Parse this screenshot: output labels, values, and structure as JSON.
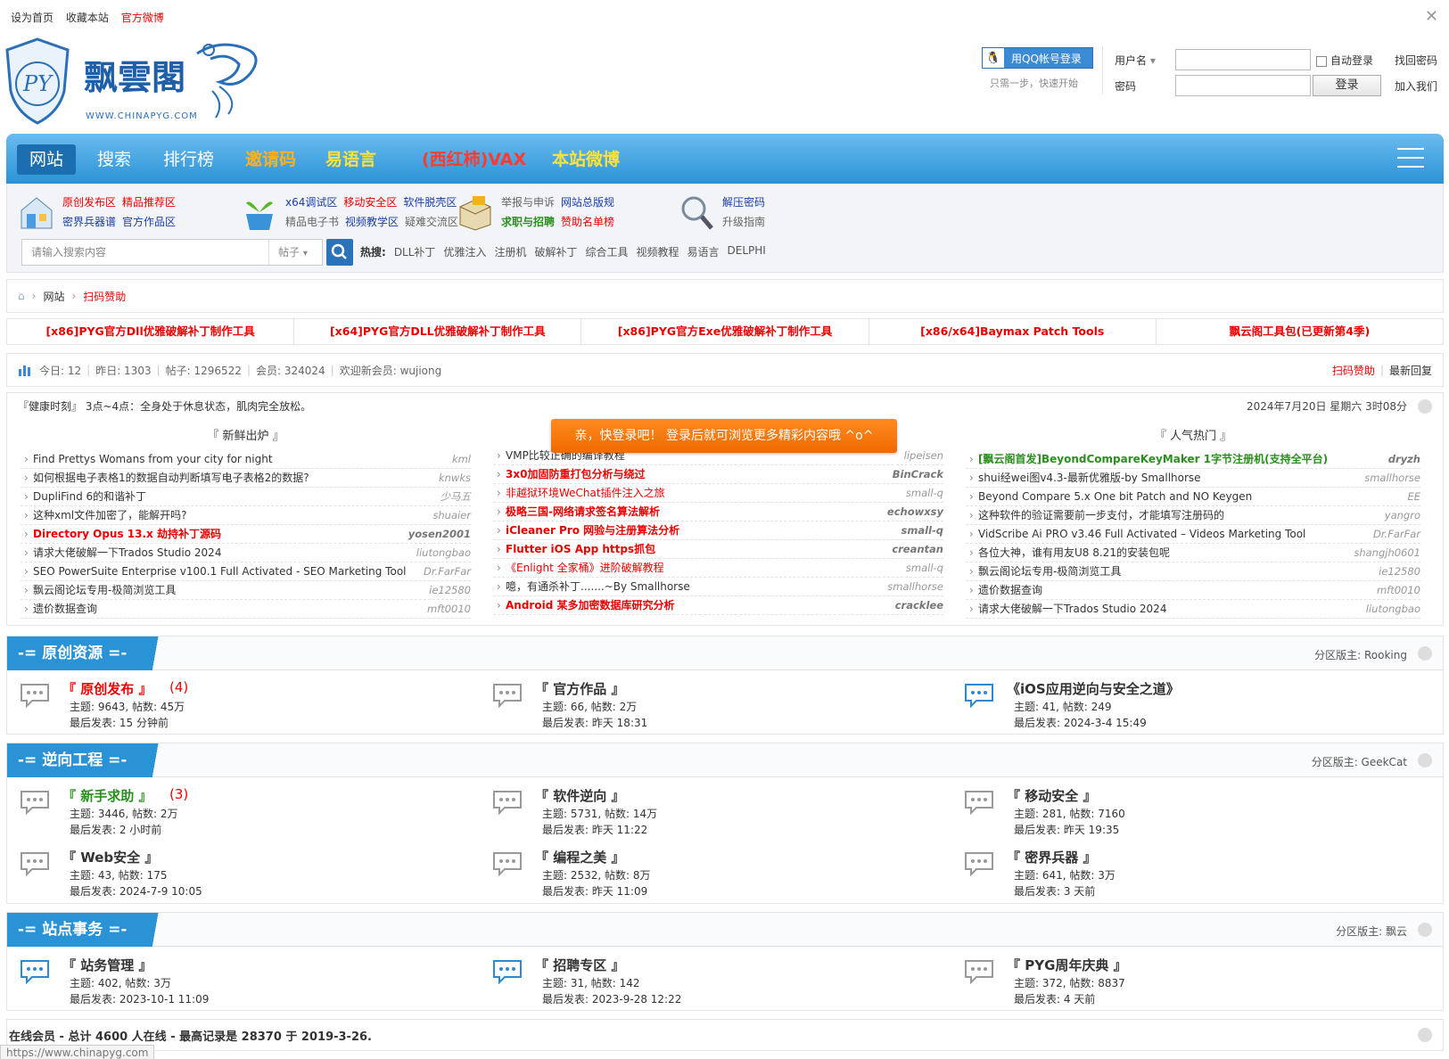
{
  "topbar": {
    "set_home": "设为首页",
    "bookmark": "收藏本站",
    "weibo": "官方微博"
  },
  "logo": {
    "name": "飘雲閣",
    "url": "WWW.CHINAPYG.COM",
    "mark": "PY"
  },
  "login": {
    "qq_button": "用QQ帐号登录",
    "qq_sub": "只需一步，快速开始",
    "username_label": "用户名",
    "password_label": "密码",
    "auto_login": "自动登录",
    "find_password": "找回密码",
    "login_button": "登录",
    "join": "加入我们"
  },
  "nav": {
    "items": [
      {
        "label": "网站"
      },
      {
        "label": "搜索"
      },
      {
        "label": "排行榜"
      },
      {
        "label": "邀请码"
      },
      {
        "label": "易语言"
      },
      {
        "label": "(西红柿)VAX"
      },
      {
        "label": "本站微博"
      }
    ]
  },
  "quick": {
    "g1": {
      "r1": [
        "原创发布区",
        "精品推荐区"
      ],
      "r2": [
        "密界兵器谱",
        "官方作品区"
      ]
    },
    "g2": {
      "r1": [
        "x64调试区",
        "移动安全区",
        "软件脱壳区"
      ],
      "r2": [
        "精品电子书",
        "视频教学区",
        "疑难交流区"
      ]
    },
    "g3": {
      "r1": [
        "举报与申诉",
        "网站总版规"
      ],
      "r2": [
        "求职与招聘",
        "赞助名单榜"
      ]
    },
    "g4": {
      "r1": [
        "解压密码"
      ],
      "r2": [
        "升级指南"
      ]
    }
  },
  "search": {
    "placeholder": "请输入搜索内容",
    "type": "帖子",
    "hot_label": "热搜:",
    "hot": [
      "DLL补丁",
      "优雅注入",
      "注册机",
      "破解补丁",
      "综合工具",
      "视频教程",
      "易语言",
      "DELPHI"
    ]
  },
  "breadcrumb": {
    "home": "网站",
    "current": "扫码赞助"
  },
  "ticker": [
    "[x86]PYG官方Dll优雅破解补丁制作工具",
    "[x64]PYG官方DLL优雅破解补丁制作工具",
    "[x86]PYG官方Exe优雅破解补丁制作工具",
    "[x86/x64]Baymax Patch Tools",
    "飘云阁工具包(已更新第4季)"
  ],
  "stats": {
    "today": "今日: 12",
    "yesterday": "昨日: 1303",
    "posts": "帖子: 1296522",
    "members": "会员: 324024",
    "welcome": "欢迎新会员: wujiong",
    "sponsor": "扫码赞助",
    "latest": "最新回复"
  },
  "tip": {
    "text": "『健康时刻』 3点~4点：全身处于休息状态，肌肉完全放松。",
    "date": "2024年7月20日 星期六 3时08分"
  },
  "popup": "亲，快登录吧！ 登录后就可浏览更多精彩内容哦 ^o^",
  "lists": {
    "new": {
      "title": "『 新鲜出炉 』",
      "items": [
        {
          "t": "Find Prettys Womans from your city for night",
          "a": "kml"
        },
        {
          "t": "如何根据电子表格1的数据自动判断填写电子表格2的数据?",
          "a": "knwks"
        },
        {
          "t": "DupliFind 6的和谐补丁",
          "a": "少马五"
        },
        {
          "t": "这种xml文件加密了，能解开吗?",
          "a": "shuaier"
        },
        {
          "t": "Directory Opus 13.x 劫持补丁源码",
          "a": "yosen2001"
        },
        {
          "t": "请求大佬破解一下Trados Studio 2024",
          "a": "liutongbao"
        },
        {
          "t": "SEO PowerSuite Enterprise v100.1 Full Activated - SEO Marketing Tool",
          "a": "Dr.FarFar"
        },
        {
          "t": "飘云阁论坛专用-极简浏览工具",
          "a": "ie12580"
        },
        {
          "t": "遗价数据查询",
          "a": "mft0010"
        }
      ]
    },
    "hot": {
      "items": [
        {
          "t": "VMP比较正确的编译教程",
          "a": "lipeisen"
        },
        {
          "t": "3x0加固防重打包分析与绕过",
          "a": "BinCrack"
        },
        {
          "t": "非越狱环境WeChat插件注入之旅",
          "a": "small-q"
        },
        {
          "t": "极略三国-网络请求签名算法解析",
          "a": "echowxsy"
        },
        {
          "t": "iCleaner Pro 网验与注册算法分析",
          "a": "small-q"
        },
        {
          "t": "Flutter iOS App https抓包",
          "a": "creantan"
        },
        {
          "t": "《Enlight 全家桶》进阶破解教程",
          "a": "small-q"
        },
        {
          "t": "噫，有通杀补丁.......~By Smallhorse",
          "a": "smallhorse"
        },
        {
          "t": "Android 某多加密数据库研究分析",
          "a": "cracklee"
        }
      ]
    },
    "pop": {
      "title": "『 人气热门 』",
      "items": [
        {
          "t": "[飘云阁首发]BeyondCompareKeyMaker 1字节注册机(支持全平台)",
          "a": "dryzh"
        },
        {
          "t": "shui经wei图v4.3-最新优雅版-by Smallhorse",
          "a": "smallhorse"
        },
        {
          "t": "Beyond Compare 5.x One bit Patch and NO Keygen",
          "a": "EE"
        },
        {
          "t": "这种软件的验证需要前一步支付，才能填写注册码的",
          "a": "yangro"
        },
        {
          "t": "VidScribe Ai PRO v3.46 Full Activated – Videos Marketing Tool",
          "a": "Dr.FarFar"
        },
        {
          "t": "各位大神，谁有用友U8 8.21的安装包呢",
          "a": "shangjh0601"
        },
        {
          "t": "飘云阁论坛专用-极简浏览工具",
          "a": "ie12580"
        },
        {
          "t": "遗价数据查询",
          "a": "mft0010"
        },
        {
          "t": "请求大佬破解一下Trados Studio 2024",
          "a": "liutongbao"
        }
      ]
    }
  },
  "sections": {
    "s1": {
      "title": "-= 原创资源 =-",
      "mod": "分区版主: Rooking",
      "forums": [
        {
          "name": "『 原创发布 』",
          "count": "(4)",
          "stats": "主题: 9643, 帖数: 45万",
          "last": "最后发表: 15 分钟前"
        },
        {
          "name": "『 官方作品 』",
          "count": "",
          "stats": "主题: 66, 帖数: 2万",
          "last": "最后发表: 昨天 18:31"
        },
        {
          "name": "《iOS应用逆向与安全之道》",
          "count": "",
          "stats": "主题: 41, 帖数: 249",
          "last": "最后发表: 2024-3-4 15:49"
        }
      ]
    },
    "s2": {
      "title": "-= 逆向工程 =-",
      "mod": "分区版主: GeekCat",
      "forums": [
        {
          "name": "『 新手求助 』",
          "count": "(3)",
          "stats": "主题: 3446, 帖数: 2万",
          "last": "最后发表: 2 小时前"
        },
        {
          "name": "『 软件逆向 』",
          "count": "",
          "stats": "主题: 5731, 帖数: 14万",
          "last": "最后发表: 昨天 11:22"
        },
        {
          "name": "『 移动安全 』",
          "count": "",
          "stats": "主题: 281, 帖数: 7160",
          "last": "最后发表: 昨天 19:35"
        },
        {
          "name": "『 Web安全 』",
          "count": "",
          "stats": "主题: 43, 帖数: 175",
          "last": "最后发表: 2024-7-9 10:05"
        },
        {
          "name": "『 编程之美 』",
          "count": "",
          "stats": "主题: 2532, 帖数: 8万",
          "last": "最后发表: 昨天 11:09"
        },
        {
          "name": "『 密界兵器 』",
          "count": "",
          "stats": "主题: 641, 帖数: 3万",
          "last": "最后发表: 3 天前"
        }
      ]
    },
    "s3": {
      "title": "-= 站点事务 =-",
      "mod": "分区版主: 飘云",
      "forums": [
        {
          "name": "『 站务管理 』",
          "count": "",
          "stats": "主题: 402, 帖数: 3万",
          "last": "最后发表: 2023-10-1 11:09"
        },
        {
          "name": "『 招聘专区 』",
          "count": "",
          "stats": "主题: 31, 帖数: 142",
          "last": "最后发表: 2023-9-28 12:22"
        },
        {
          "name": "『 PYG周年庆典 』",
          "count": "",
          "stats": "主题: 372, 帖数: 8837",
          "last": "最后发表: 4 天前"
        }
      ]
    }
  },
  "footer": {
    "online": "在线会员 - 总计 4600 人在线 - 最高记录是 28370 于 2019-3-26."
  },
  "statusbar": "https://www.chinapyg.com"
}
